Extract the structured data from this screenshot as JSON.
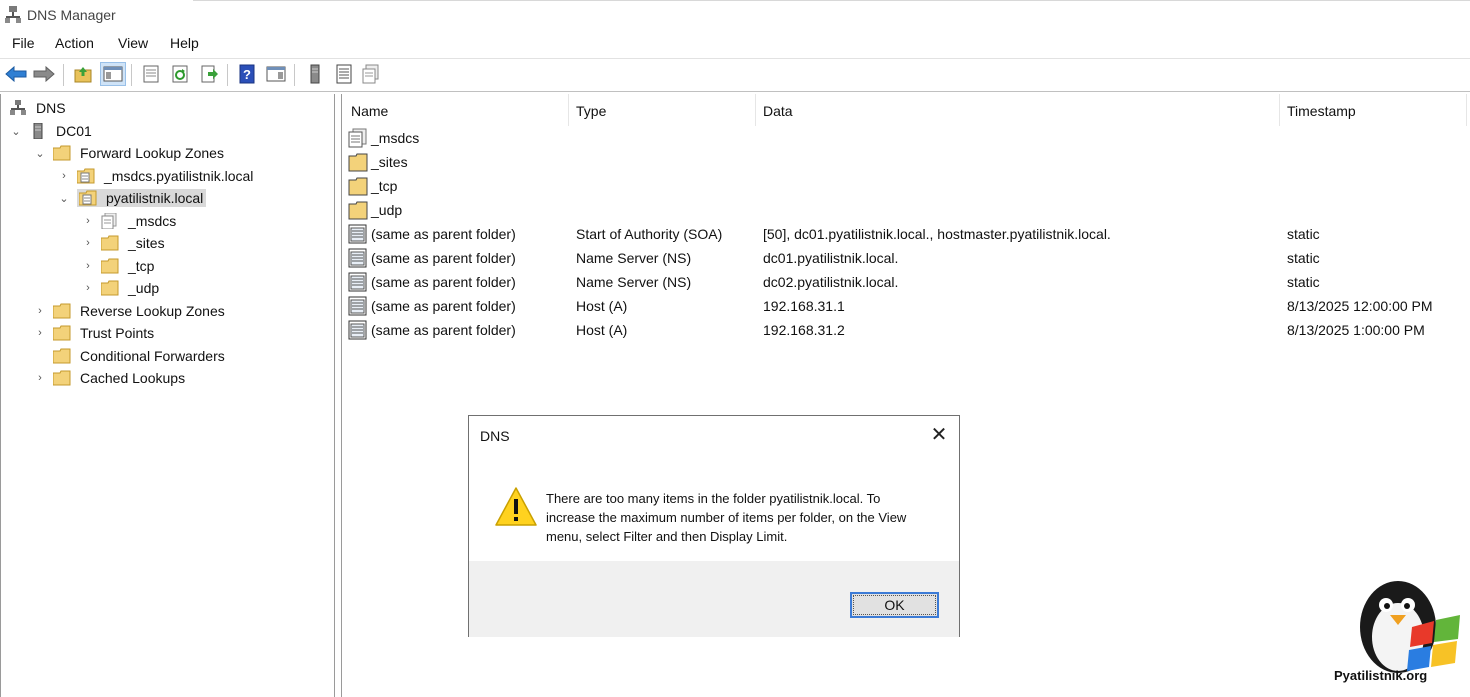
{
  "window": {
    "title": "DNS Manager"
  },
  "menu": [
    "File",
    "Action",
    "View",
    "Help"
  ],
  "toolbar": {
    "buttons": [
      "back-icon",
      "forward-icon",
      "up-folder-icon",
      "show-hide-tree-icon",
      "properties-icon",
      "refresh-icon",
      "export-list-icon",
      "help-icon",
      "show-hide-action-pane-icon",
      "server-icon",
      "record-icon",
      "copy-record-icon"
    ]
  },
  "tree": {
    "root": "DNS",
    "server": "DC01",
    "forward_zones": "Forward Lookup Zones",
    "msdcs_zone": "_msdcs.pyatilistnik.local",
    "selected_zone": "pyatilistnik.local",
    "sub_msdcs": "_msdcs",
    "sub_sites": "_sites",
    "sub_tcp": "_tcp",
    "sub_udp": "_udp",
    "reverse_zones": "Reverse Lookup Zones",
    "trust_points": "Trust Points",
    "conditional_forwarders": "Conditional Forwarders",
    "cached_lookups": "Cached Lookups"
  },
  "list": {
    "columns": {
      "name": "Name",
      "type": "Type",
      "data": "Data",
      "timestamp": "Timestamp"
    },
    "rows": [
      {
        "name": "_msdcs",
        "type": "",
        "data": "",
        "timestamp": "",
        "icon": "delegated-zone-icon"
      },
      {
        "name": "_sites",
        "type": "",
        "data": "",
        "timestamp": "",
        "icon": "folder-icon"
      },
      {
        "name": "_tcp",
        "type": "",
        "data": "",
        "timestamp": "",
        "icon": "folder-icon"
      },
      {
        "name": "_udp",
        "type": "",
        "data": "",
        "timestamp": "",
        "icon": "folder-icon"
      },
      {
        "name": "(same as parent folder)",
        "type": "Start of Authority (SOA)",
        "data": "[50], dc01.pyatilistnik.local., hostmaster.pyatilistnik.local.",
        "timestamp": "static",
        "icon": "record-icon"
      },
      {
        "name": "(same as parent folder)",
        "type": "Name Server (NS)",
        "data": "dc01.pyatilistnik.local.",
        "timestamp": "static",
        "icon": "record-icon"
      },
      {
        "name": "(same as parent folder)",
        "type": "Name Server (NS)",
        "data": "dc02.pyatilistnik.local.",
        "timestamp": "static",
        "icon": "record-icon"
      },
      {
        "name": "(same as parent folder)",
        "type": "Host (A)",
        "data": "192.168.31.1",
        "timestamp": "8/13/2025 12:00:00 PM",
        "icon": "record-icon"
      },
      {
        "name": "(same as parent folder)",
        "type": "Host (A)",
        "data": "192.168.31.2",
        "timestamp": "8/13/2025 1:00:00 PM",
        "icon": "record-icon"
      }
    ]
  },
  "dialog": {
    "title": "DNS",
    "close": "✕",
    "message": "There are too many items in the folder pyatilistnik.local. To increase the maximum number of items per folder, on the View menu, select Filter and then Display Limit.",
    "ok_label": "OK",
    "icon": "warning-icon"
  },
  "watermark": {
    "text": "Pyatilistnik.org"
  }
}
